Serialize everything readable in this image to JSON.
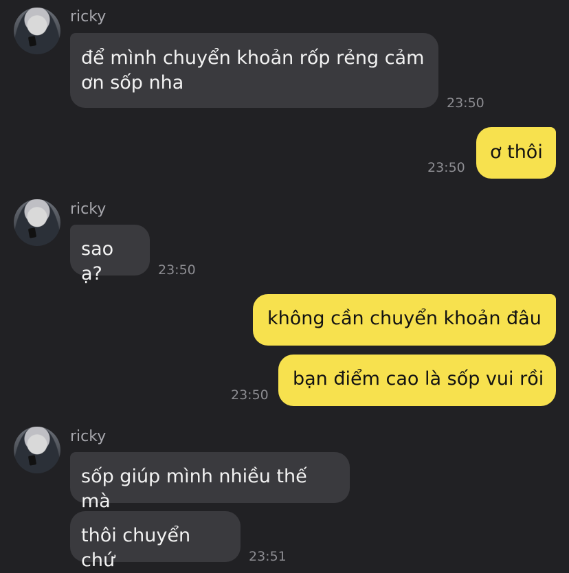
{
  "messages": [
    {
      "sender": "ricky",
      "text": "để mình chuyển khoản rốp rẻng cảm ơn sốp nha",
      "time": "23:50"
    },
    {
      "text": "ơ thôi",
      "time": "23:50"
    },
    {
      "sender": "ricky",
      "text": "sao ạ?",
      "time": "23:50"
    },
    {
      "text": "không cần chuyển khoản đâu"
    },
    {
      "text": "bạn điểm cao là sốp vui rồi",
      "time": "23:50"
    },
    {
      "sender": "ricky",
      "text": "sốp giúp mình nhiều thế mà"
    },
    {
      "text": "thôi chuyển chứ",
      "time": "23:51"
    }
  ],
  "colors": {
    "background": "#212124",
    "incoming_bubble": "#3a3a3e",
    "outgoing_bubble": "#f7e14e"
  }
}
